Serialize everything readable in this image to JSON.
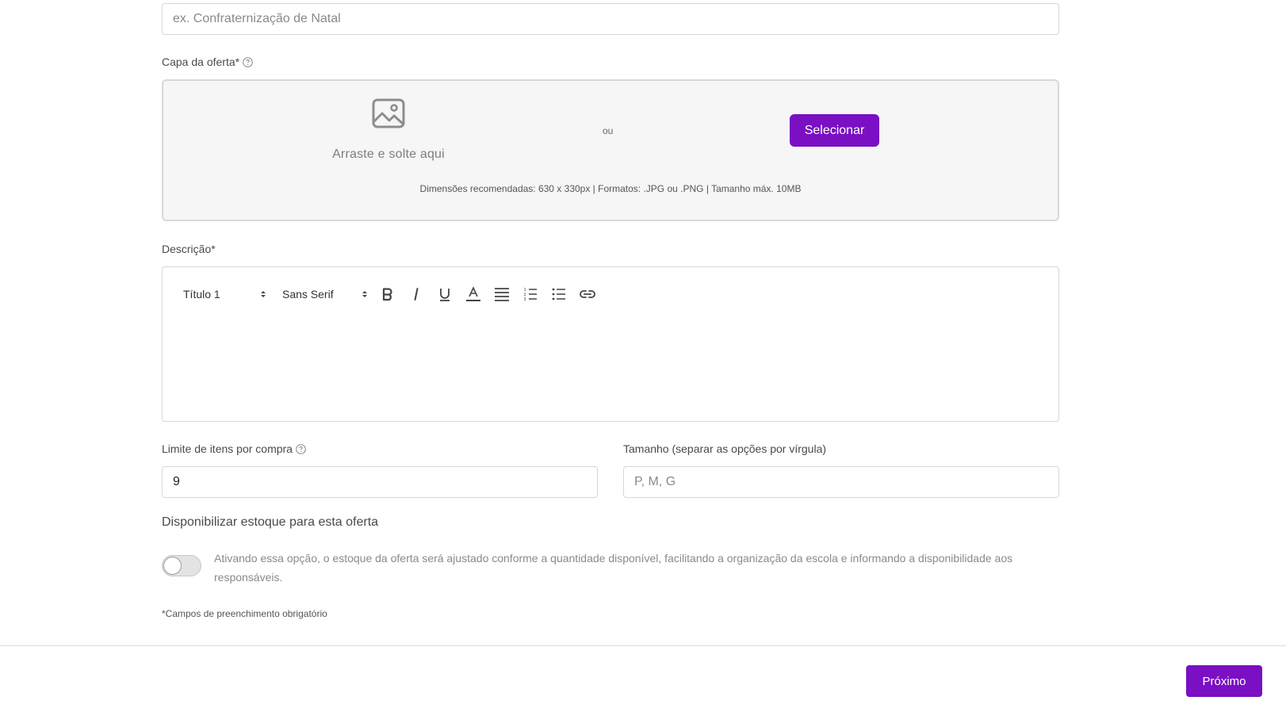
{
  "name_field": {
    "placeholder": "ex. Confraternização de Natal",
    "value": ""
  },
  "cover": {
    "label": "Capa da oferta*",
    "drag_text": "Arraste e solte aqui",
    "or_text": "ou",
    "select_label": "Selecionar",
    "hint": "Dimensões recomendadas: 630 x 330px | Formatos: .JPG ou .PNG | Tamanho máx. 10MB",
    "icon": "image-icon"
  },
  "description": {
    "label": "Descrição*",
    "toolbar": {
      "heading_value": "Título 1",
      "font_value": "Sans Serif",
      "buttons": [
        "bold-icon",
        "italic-icon",
        "underline-icon",
        "text-color-icon",
        "align-icon",
        "ordered-list-icon",
        "bullet-list-icon",
        "link-icon"
      ]
    }
  },
  "limit": {
    "label": "Limite de itens por compra",
    "value": "9"
  },
  "size": {
    "label": "Tamanho (separar as opções por vírgula)",
    "placeholder": "P, M, G",
    "value": ""
  },
  "stock": {
    "title": "Disponibilizar estoque para esta oferta",
    "toggle_on": false,
    "description": "Ativando essa opção, o estoque da oferta será ajustado conforme a quantidade disponível, facilitando a organização da escola e informando a disponibilidade aos responsáveis."
  },
  "required_note": "*Campos de preenchimento obrigatório",
  "footer": {
    "next_label": "Próximo"
  },
  "colors": {
    "primary": "#7a0fc4",
    "border": "#d6d6d6",
    "dropzone_bg": "#f6f6f6"
  }
}
